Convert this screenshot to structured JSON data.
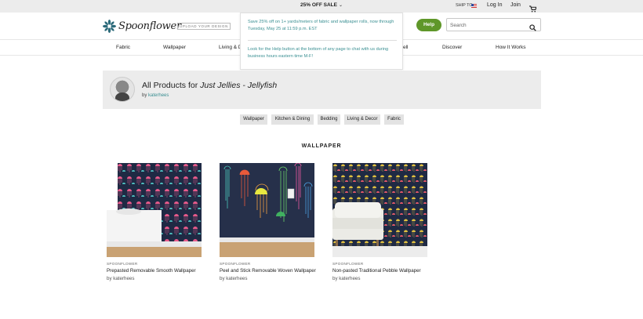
{
  "topbar": {
    "promo": "25% OFF SALE",
    "ship_to": "SHIP TO",
    "login": "Log In",
    "join": "Join"
  },
  "header": {
    "logo_text": "Spoonflower",
    "upload_label": "UPLOAD YOUR DESIGN",
    "help_label": "Help",
    "search_placeholder": "Search"
  },
  "nav": {
    "items": [
      "Fabric",
      "Wallpaper",
      "Living & De",
      "ell",
      "Discover",
      "How It Works"
    ]
  },
  "popover": {
    "text1": "Save 25% off on 1+ yards/meters of fabric and wallpaper rolls, now through Tuesday, May 25 at 11:59 p.m. EST",
    "text2": "Look for the Help button at the bottom of any page to chat with us during business hours eastern time M-F!"
  },
  "product_header": {
    "title_prefix": "All Products for ",
    "title_design": "Just Jellies - Jellyfish",
    "by_label": "by",
    "designer": "katerhees"
  },
  "categories": [
    "Wallpaper",
    "Kitchen & Dining",
    "Bedding",
    "Living & Decor",
    "Fabric"
  ],
  "section": {
    "title": "WALLPAPER"
  },
  "products": [
    {
      "brand": "SPOONFLOWER",
      "name": "Prepasted Removable Smooth Wallpaper",
      "by": "by katerhees"
    },
    {
      "brand": "SPOONFLOWER",
      "name": "Peel and Stick Removable Woven Wallpaper",
      "by": "by katerhees"
    },
    {
      "brand": "SPOONFLOWER",
      "name": "Non-pasted Traditional Pebble Wallpaper",
      "by": "by katerhees"
    }
  ],
  "colors": {
    "accent_green": "#5f9729",
    "link_teal": "#3a8f92",
    "wallpaper_bg": "#1f2a44"
  }
}
